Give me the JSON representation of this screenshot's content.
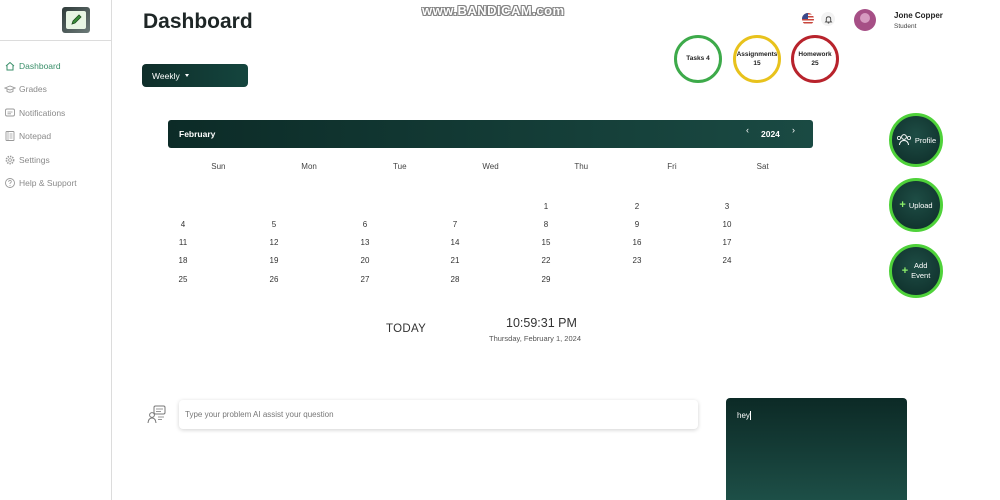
{
  "watermark": "www.BANDICAM.com",
  "sidebar": {
    "items": [
      {
        "label": "Dashboard",
        "icon": "home-icon"
      },
      {
        "label": "Grades",
        "icon": "graduation-cap-icon"
      },
      {
        "label": "Notifications",
        "icon": "message-icon"
      },
      {
        "label": "Notepad",
        "icon": "notepad-icon"
      },
      {
        "label": "Settings",
        "icon": "gear-icon"
      },
      {
        "label": "Help & Support",
        "icon": "help-icon"
      }
    ],
    "active_index": 0
  },
  "header": {
    "title": "Dashboard",
    "user_name": "Jone Copper",
    "user_role": "Student"
  },
  "view_dropdown": {
    "selected": "Weekly"
  },
  "stats": {
    "tasks": {
      "label": "Tasks",
      "value": "4"
    },
    "assignments": {
      "label": "Assignments",
      "value": "15"
    },
    "homework": {
      "label": "Homework",
      "value": "25"
    }
  },
  "actions": {
    "profile": "Profile",
    "upload": "Upload",
    "add_event_line1": "Add",
    "add_event_line2": "Event"
  },
  "calendar": {
    "month": "February",
    "year": "2024",
    "prev": "‹",
    "next": "›",
    "weekdays": [
      "Sun",
      "Mon",
      "Tue",
      "Wed",
      "Thu",
      "Fri",
      "Sat"
    ],
    "first_weekday_index": 4,
    "days_in_month": 29
  },
  "today": {
    "label": "TODAY",
    "time": "10:59:31 PM",
    "date": "Thursday, February 1, 2024"
  },
  "ai_assist": {
    "placeholder": "Type your problem AI assist your question"
  },
  "chat": {
    "text": "hey"
  },
  "colors": {
    "accent_dark": "#0f2e2a",
    "accent_green": "#4fd23a",
    "tasks_ring": "#3daa4a",
    "assignments_ring": "#e8c21c",
    "homework_ring": "#b8232c"
  }
}
